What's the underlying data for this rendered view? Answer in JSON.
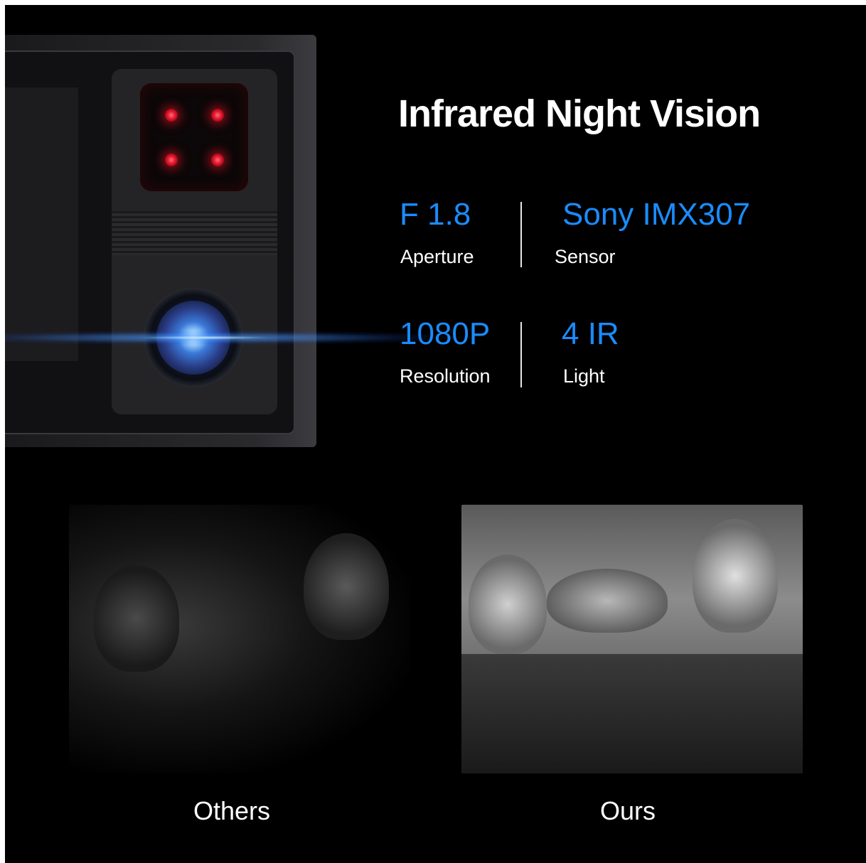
{
  "headline": "Infrared Night Vision",
  "specs": [
    {
      "value": "F 1.8",
      "label": "Aperture"
    },
    {
      "value": "Sony IMX307",
      "label": "Sensor"
    },
    {
      "value": "1080P",
      "label": "Resolution"
    },
    {
      "value": "4 IR",
      "label": "Light"
    }
  ],
  "comparison": {
    "others_caption": "Others",
    "ours_caption": "Ours"
  },
  "colors": {
    "background": "#000000",
    "accent_blue": "#1a8cff",
    "ir_red": "#e0142b",
    "text": "#ffffff"
  }
}
